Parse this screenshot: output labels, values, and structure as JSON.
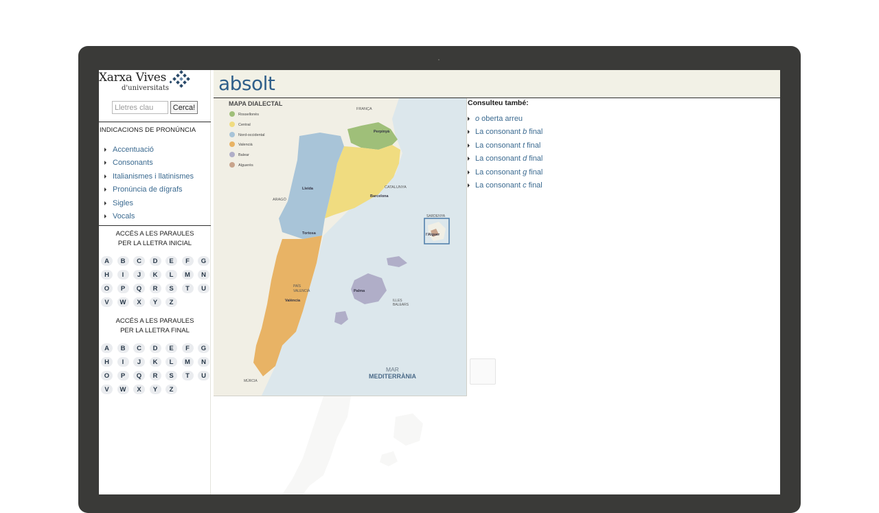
{
  "logo": {
    "title": "Xarxa Vives",
    "subtitle": "d'universitats"
  },
  "search": {
    "placeholder": "Lletres clau",
    "button_label": "Cerca!"
  },
  "pronunciation": {
    "title": "INDICACIONS DE PRONÚNCIA",
    "items": [
      {
        "label": "Accentuació"
      },
      {
        "label": "Consonants"
      },
      {
        "label": "Italianismes i llatinismes"
      },
      {
        "label": "Pronúncia de dígrafs"
      },
      {
        "label": "Sigles"
      },
      {
        "label": "Vocals"
      }
    ]
  },
  "initial_letters": {
    "title_line1": "ACCÉS A LES PARAULES",
    "title_line2": "PER LA LLETRA INICIAL",
    "letters": [
      "A",
      "B",
      "C",
      "D",
      "E",
      "F",
      "G",
      "H",
      "I",
      "J",
      "K",
      "L",
      "M",
      "N",
      "O",
      "P",
      "Q",
      "R",
      "S",
      "T",
      "U",
      "V",
      "W",
      "X",
      "Y",
      "Z"
    ]
  },
  "final_letters": {
    "title_line1": "ACCÉS A LES PARAULES",
    "title_line2": "PER LA LLETRA FINAL",
    "letters": [
      "A",
      "B",
      "C",
      "D",
      "E",
      "F",
      "G",
      "H",
      "I",
      "J",
      "K",
      "L",
      "M",
      "N",
      "O",
      "P",
      "Q",
      "R",
      "S",
      "T",
      "U",
      "V",
      "W",
      "X",
      "Y",
      "Z"
    ]
  },
  "word": {
    "title": "absolt"
  },
  "map": {
    "title": "MAPA DIALECTAL",
    "legend": [
      {
        "label": "Rossellonès",
        "color": "#9fbf79"
      },
      {
        "label": "Central",
        "color": "#f0dc80"
      },
      {
        "label": "Nord-occidental",
        "color": "#a8c4d8"
      },
      {
        "label": "Valencià",
        "color": "#e8b365"
      },
      {
        "label": "Balear",
        "color": "#b0aec8"
      },
      {
        "label": "Alguerès",
        "color": "#c8a48c"
      }
    ],
    "labels": {
      "franca": "FRANÇA",
      "perpinya": "Perpinyà",
      "catalunya": "CATALUNYA",
      "barcelona": "Barcelona",
      "lleida": "Lleida",
      "arago": "ARAGÓ",
      "tortosa": "Tortosa",
      "sardenya": "SARDENYA",
      "alguer": "l'Alguer",
      "pais_valencia_1": "PAÍS",
      "pais_valencia_2": "VALENCIÀ",
      "valencia": "València",
      "palma": "Palma",
      "illes_1": "ILLES",
      "illes_2": "BALEARS",
      "mar": "MAR",
      "mediterrania": "MEDITERRÀNIA",
      "murcia": "MÚRCIA"
    }
  },
  "related": {
    "title": "Consulteu també:",
    "items": [
      {
        "italic": "o",
        "label": "oberta arreu",
        "prefix": ""
      },
      {
        "prefix": "La consonant",
        "italic": "b",
        "label": "final"
      },
      {
        "prefix": "La consonant",
        "italic": "t",
        "label": "final"
      },
      {
        "prefix": "La consonant",
        "italic": "d",
        "label": "final"
      },
      {
        "prefix": "La consonant",
        "italic": "g",
        "label": "final"
      },
      {
        "prefix": "La consonant",
        "italic": "c",
        "label": "final"
      }
    ]
  }
}
